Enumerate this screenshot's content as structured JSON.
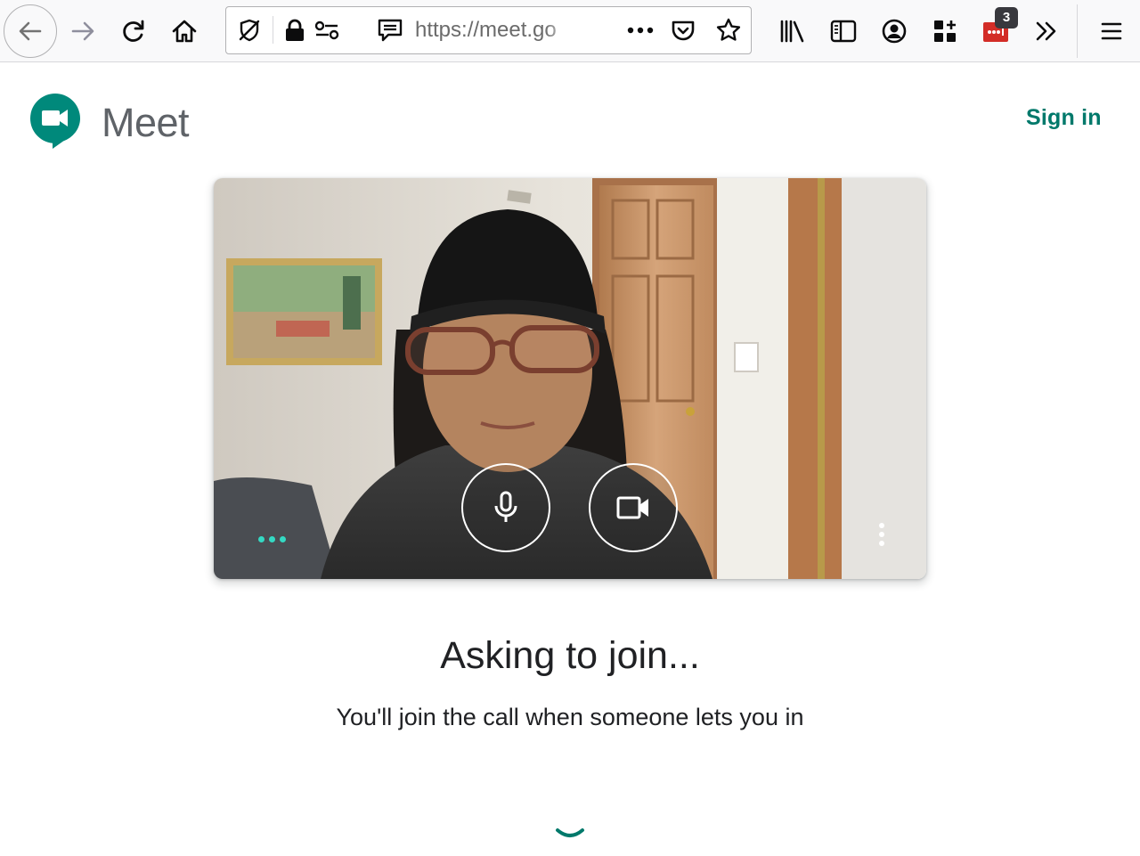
{
  "browser": {
    "url": "https://meet.go",
    "extension_badge": "3",
    "icons": {
      "back": "arrow-left-icon",
      "forward": "arrow-right-icon",
      "reload": "reload-icon",
      "home": "home-icon",
      "tracking": "tracking-protection-icon",
      "lock": "lock-icon",
      "permissions": "permissions-icon",
      "reader": "reader-view-icon",
      "page_actions": "ellipsis-icon",
      "pocket": "pocket-icon",
      "bookmark": "star-icon",
      "library": "library-icon",
      "sidebar": "sidebar-icon",
      "account": "account-icon",
      "containers": "containers-icon",
      "extension": "password-manager-icon",
      "overflow": "chevron-double-right-icon",
      "menu": "hamburger-menu-icon"
    }
  },
  "meet": {
    "brand": "Meet",
    "sign_in": "Sign in",
    "accent_color": "#00796b",
    "logo_color": "#00897b"
  },
  "preview": {
    "icons": {
      "mic": "microphone-icon",
      "camera": "video-camera-icon",
      "more": "more-vert-icon",
      "audio_level": "audio-level-icon"
    }
  },
  "status": {
    "title": "Asking to join...",
    "subtitle": "You'll join the call when someone lets you in"
  }
}
